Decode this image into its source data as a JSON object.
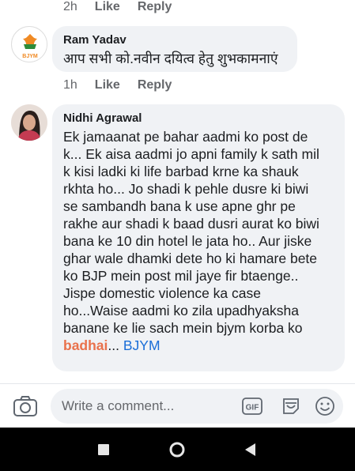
{
  "top_actions": {
    "time": "2h",
    "like": "Like",
    "reply": "Reply"
  },
  "comments": [
    {
      "author": "Ram Yadav",
      "avatar": "bjym-logo",
      "avatar_label": "BJYM",
      "text": "आप सभी को.नवीन दयित्व हेतु शुभकामनाएं",
      "actions": {
        "time": "1h",
        "like": "Like",
        "reply": "Reply"
      }
    },
    {
      "author": "Nidhi Agrawal",
      "avatar": "profile-photo",
      "lines": [
        "Ek jamaanat pe bahar aadmi ko post de",
        "k... Ek aisa aadmi jo apni family k sath mil",
        "k kisi ladki ki life barbad krne ka shauk",
        "rkhta ho... Jo shadi k pehle dusre ki biwi",
        "se sambandh bana k use apne ghr pe",
        "rakhe aur shadi k baad dusri aurat ko biwi",
        "bana ke 10 din hotel le jata ho.. Aur jiske",
        "ghar wale dhamki dete ho ki hamare bete",
        "ko BJP mein post mil jaye fir btaenge..",
        "Jispe domestic violence ka case",
        "ho...Waise aadmi ko zila upadhyaksha",
        "banane  ke lie sach mein bjym korba ko"
      ],
      "last_highlight": "badhai",
      "last_mid": "... ",
      "last_tag": "BJYM"
    }
  ],
  "composer": {
    "placeholder": "Write a comment..."
  },
  "colors": {
    "bubble": "#f0f2f5",
    "secondary_text": "#65676b",
    "link": "#1a6ed8",
    "highlight": "#e9714b",
    "saffron": "#f08a24"
  }
}
